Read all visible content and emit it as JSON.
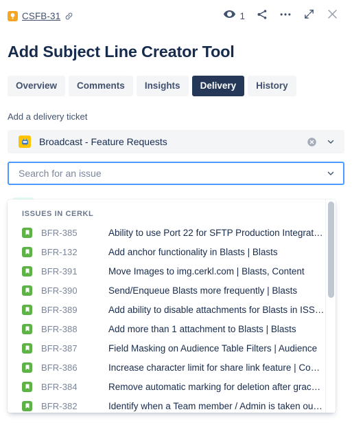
{
  "header": {
    "issue_key": "CSFB-31",
    "type_icon": "lightbulb-icon",
    "link_icon": "link-icon",
    "watch_icon": "eye-icon",
    "watch_count": "1",
    "share_icon": "share-icon",
    "more_icon": "more-options-icon",
    "expand_icon": "expand-icon",
    "close_icon": "close-icon"
  },
  "title": "Add Subject Line Creator Tool",
  "tabs": [
    {
      "label": "Overview",
      "active": false
    },
    {
      "label": "Comments",
      "active": false
    },
    {
      "label": "Insights",
      "active": false
    },
    {
      "label": "Delivery",
      "active": true
    },
    {
      "label": "History",
      "active": false
    }
  ],
  "delivery": {
    "field_label": "Add a delivery ticket",
    "project_select": {
      "value": "Broadcast - Feature Requests",
      "icon": "broadcast-project-icon",
      "clear_icon": "clear-icon",
      "chevron_icon": "chevron-down-icon"
    },
    "issue_search": {
      "value": "",
      "placeholder": "Search for an issue",
      "chevron_icon": "chevron-down-icon"
    }
  },
  "dropdown": {
    "group_title": "ISSUES IN CERKL",
    "options": [
      {
        "key": "BFR-385",
        "summary": "Ability to use Port 22 for SFTP Production Integratio…"
      },
      {
        "key": "BFR-132",
        "summary": "Add anchor functionality in Blasts | Blasts"
      },
      {
        "key": "BFR-391",
        "summary": "Move Images to img.cerkl.com | Blasts, Content"
      },
      {
        "key": "BFR-390",
        "summary": "Send/Enqueue Blasts more frequently | Blasts"
      },
      {
        "key": "BFR-389",
        "summary": "Add ability to disable attachments for Blasts in ISS | …"
      },
      {
        "key": "BFR-388",
        "summary": "Add more than 1 attachment to Blasts | Blasts"
      },
      {
        "key": "BFR-387",
        "summary": "Field Masking on Audience Table Filters | Audience"
      },
      {
        "key": "BFR-386",
        "summary": "Increase character limit for share link feature | Conte…"
      },
      {
        "key": "BFR-384",
        "summary": "Remove automatic marking for deletion after grace …"
      },
      {
        "key": "BFR-382",
        "summary": "Identify when a Team member / Admin is taken out o…"
      }
    ]
  },
  "colors": {
    "accent_navy": "#253858",
    "focus_blue": "#4c9aff",
    "text_primary": "#172b4d",
    "text_subtle": "#7a869a",
    "issue_green": "#5fb246",
    "idea_orange": "#f5a623",
    "project_yellow": "#ffc400"
  }
}
